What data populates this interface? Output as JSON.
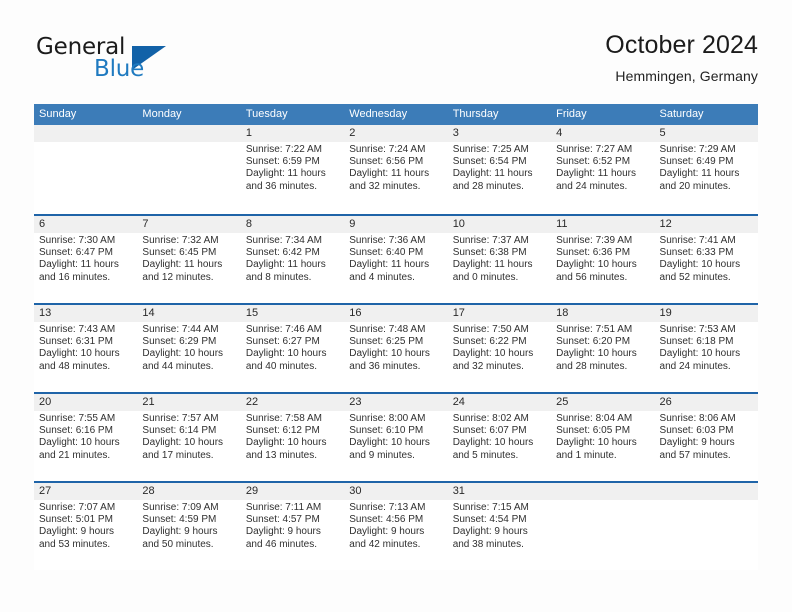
{
  "logo": {
    "word_one": "General",
    "word_two": "Blue",
    "mark": "blue-triangle"
  },
  "header": {
    "title": "October 2024",
    "subtitle": "Hemmingen, Germany"
  },
  "colors": {
    "header_blue": "#3c7cb8",
    "rule_blue": "#1f64a8",
    "daynum_band": "#f0f0f0",
    "logo_blue": "#1f7ac0",
    "text": "#303030"
  },
  "weekdays": [
    "Sunday",
    "Monday",
    "Tuesday",
    "Wednesday",
    "Thursday",
    "Friday",
    "Saturday"
  ],
  "weeks": [
    [
      {
        "day": "",
        "text": ""
      },
      {
        "day": "",
        "text": ""
      },
      {
        "day": "1",
        "text": "Sunrise: 7:22 AM\nSunset: 6:59 PM\nDaylight: 11 hours\nand 36 minutes."
      },
      {
        "day": "2",
        "text": "Sunrise: 7:24 AM\nSunset: 6:56 PM\nDaylight: 11 hours\nand 32 minutes."
      },
      {
        "day": "3",
        "text": "Sunrise: 7:25 AM\nSunset: 6:54 PM\nDaylight: 11 hours\nand 28 minutes."
      },
      {
        "day": "4",
        "text": "Sunrise: 7:27 AM\nSunset: 6:52 PM\nDaylight: 11 hours\nand 24 minutes."
      },
      {
        "day": "5",
        "text": "Sunrise: 7:29 AM\nSunset: 6:49 PM\nDaylight: 11 hours\nand 20 minutes."
      }
    ],
    [
      {
        "day": "6",
        "text": "Sunrise: 7:30 AM\nSunset: 6:47 PM\nDaylight: 11 hours\nand 16 minutes."
      },
      {
        "day": "7",
        "text": "Sunrise: 7:32 AM\nSunset: 6:45 PM\nDaylight: 11 hours\nand 12 minutes."
      },
      {
        "day": "8",
        "text": "Sunrise: 7:34 AM\nSunset: 6:42 PM\nDaylight: 11 hours\nand 8 minutes."
      },
      {
        "day": "9",
        "text": "Sunrise: 7:36 AM\nSunset: 6:40 PM\nDaylight: 11 hours\nand 4 minutes."
      },
      {
        "day": "10",
        "text": "Sunrise: 7:37 AM\nSunset: 6:38 PM\nDaylight: 11 hours\nand 0 minutes."
      },
      {
        "day": "11",
        "text": "Sunrise: 7:39 AM\nSunset: 6:36 PM\nDaylight: 10 hours\nand 56 minutes."
      },
      {
        "day": "12",
        "text": "Sunrise: 7:41 AM\nSunset: 6:33 PM\nDaylight: 10 hours\nand 52 minutes."
      }
    ],
    [
      {
        "day": "13",
        "text": "Sunrise: 7:43 AM\nSunset: 6:31 PM\nDaylight: 10 hours\nand 48 minutes."
      },
      {
        "day": "14",
        "text": "Sunrise: 7:44 AM\nSunset: 6:29 PM\nDaylight: 10 hours\nand 44 minutes."
      },
      {
        "day": "15",
        "text": "Sunrise: 7:46 AM\nSunset: 6:27 PM\nDaylight: 10 hours\nand 40 minutes."
      },
      {
        "day": "16",
        "text": "Sunrise: 7:48 AM\nSunset: 6:25 PM\nDaylight: 10 hours\nand 36 minutes."
      },
      {
        "day": "17",
        "text": "Sunrise: 7:50 AM\nSunset: 6:22 PM\nDaylight: 10 hours\nand 32 minutes."
      },
      {
        "day": "18",
        "text": "Sunrise: 7:51 AM\nSunset: 6:20 PM\nDaylight: 10 hours\nand 28 minutes."
      },
      {
        "day": "19",
        "text": "Sunrise: 7:53 AM\nSunset: 6:18 PM\nDaylight: 10 hours\nand 24 minutes."
      }
    ],
    [
      {
        "day": "20",
        "text": "Sunrise: 7:55 AM\nSunset: 6:16 PM\nDaylight: 10 hours\nand 21 minutes."
      },
      {
        "day": "21",
        "text": "Sunrise: 7:57 AM\nSunset: 6:14 PM\nDaylight: 10 hours\nand 17 minutes."
      },
      {
        "day": "22",
        "text": "Sunrise: 7:58 AM\nSunset: 6:12 PM\nDaylight: 10 hours\nand 13 minutes."
      },
      {
        "day": "23",
        "text": "Sunrise: 8:00 AM\nSunset: 6:10 PM\nDaylight: 10 hours\nand 9 minutes."
      },
      {
        "day": "24",
        "text": "Sunrise: 8:02 AM\nSunset: 6:07 PM\nDaylight: 10 hours\nand 5 minutes."
      },
      {
        "day": "25",
        "text": "Sunrise: 8:04 AM\nSunset: 6:05 PM\nDaylight: 10 hours\nand 1 minute."
      },
      {
        "day": "26",
        "text": "Sunrise: 8:06 AM\nSunset: 6:03 PM\nDaylight: 9 hours\nand 57 minutes."
      }
    ],
    [
      {
        "day": "27",
        "text": "Sunrise: 7:07 AM\nSunset: 5:01 PM\nDaylight: 9 hours\nand 53 minutes."
      },
      {
        "day": "28",
        "text": "Sunrise: 7:09 AM\nSunset: 4:59 PM\nDaylight: 9 hours\nand 50 minutes."
      },
      {
        "day": "29",
        "text": "Sunrise: 7:11 AM\nSunset: 4:57 PM\nDaylight: 9 hours\nand 46 minutes."
      },
      {
        "day": "30",
        "text": "Sunrise: 7:13 AM\nSunset: 4:56 PM\nDaylight: 9 hours\nand 42 minutes."
      },
      {
        "day": "31",
        "text": "Sunrise: 7:15 AM\nSunset: 4:54 PM\nDaylight: 9 hours\nand 38 minutes."
      },
      {
        "day": "",
        "text": ""
      },
      {
        "day": "",
        "text": ""
      }
    ]
  ]
}
